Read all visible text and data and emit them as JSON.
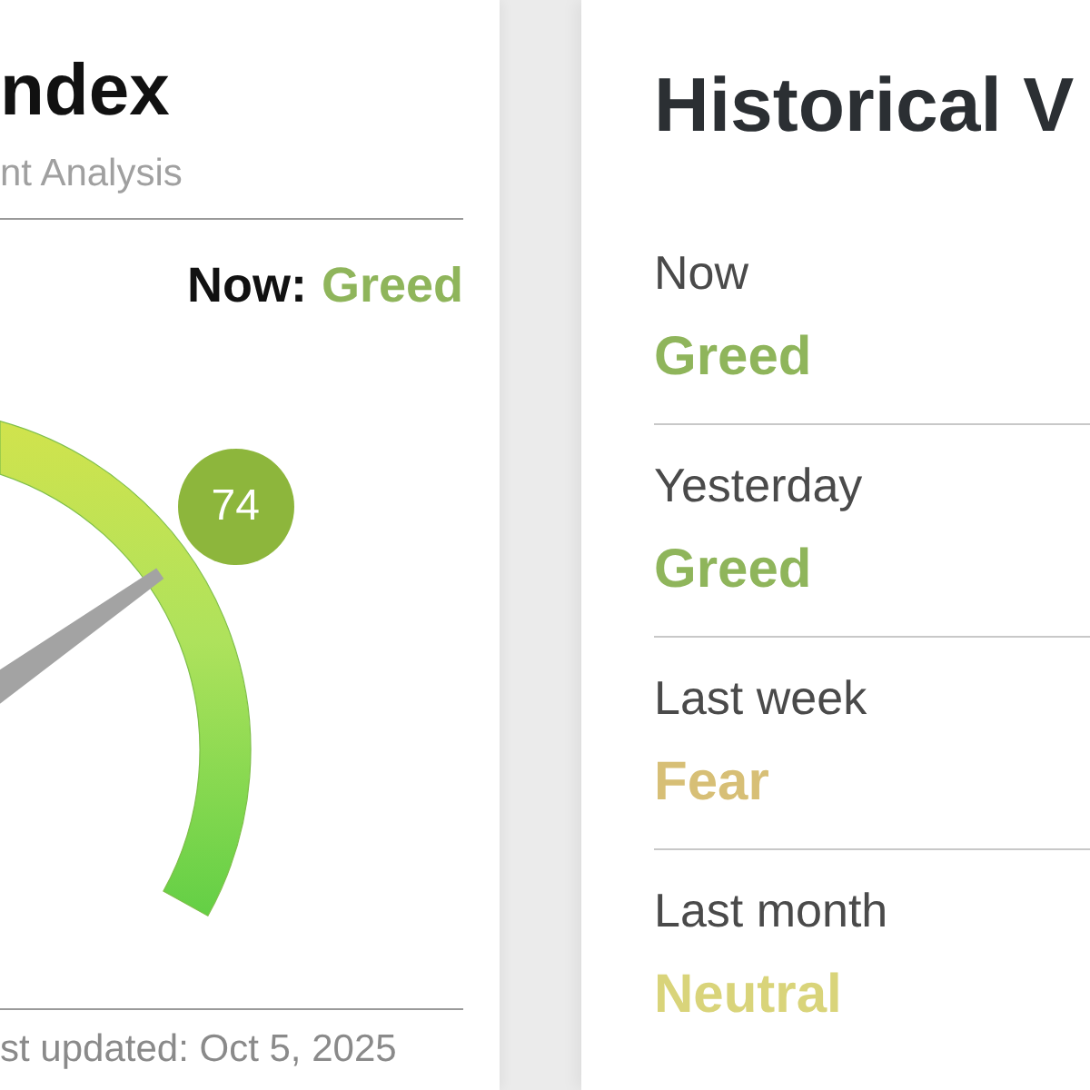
{
  "gauge_card": {
    "title": "ndex",
    "subtitle": "nt Analysis",
    "now": {
      "label": "Now:",
      "value": "Greed"
    },
    "gauge": {
      "score": "74"
    },
    "updated": "st updated: Oct 5, 2025"
  },
  "history": {
    "title": "Historical V",
    "items": [
      {
        "label": "Now",
        "value": "Greed",
        "color": "#8fb55b"
      },
      {
        "label": "Yesterday",
        "value": "Greed",
        "color": "#8fb55b"
      },
      {
        "label": "Last week",
        "value": "Fear",
        "color": "#d7bf76"
      },
      {
        "label": "Last month",
        "value": "Neutral",
        "color": "#d9d47a"
      }
    ]
  }
}
